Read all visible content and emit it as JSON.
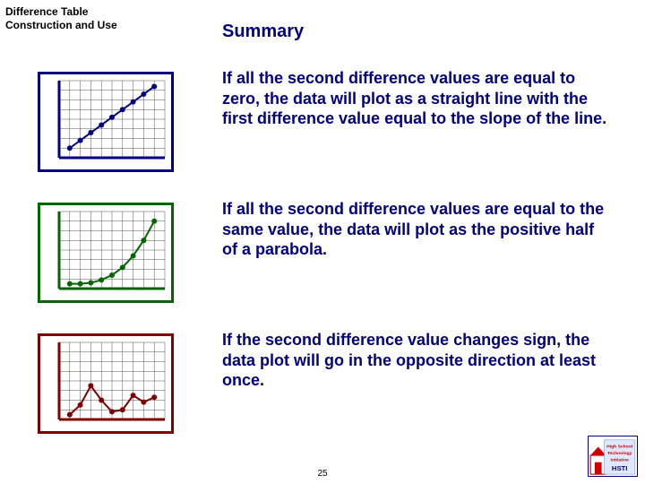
{
  "header": {
    "line1": "Difference Table",
    "line2": "Construction and Use",
    "title": "Summary"
  },
  "sections": [
    {
      "color": "navy",
      "text": "If all the second difference values are equal to zero, the data will plot as a straight line with the first difference value equal to the slope of the line."
    },
    {
      "color": "green",
      "text": "If all the second difference values are equal to the same value, the data will plot as the positive half of a parabola."
    },
    {
      "color": "red",
      "text": "If the second difference value changes sign, the data plot will go in the opposite direction at least once."
    }
  ],
  "chart_data": [
    {
      "type": "line",
      "title": "linear",
      "x": [
        1,
        2,
        3,
        4,
        5,
        6,
        7,
        8,
        9
      ],
      "y": [
        1,
        1.8,
        2.6,
        3.4,
        4.2,
        5.0,
        5.8,
        6.6,
        7.4
      ],
      "color": "#000080",
      "xlim": [
        0,
        10
      ],
      "ylim": [
        0,
        8
      ]
    },
    {
      "type": "line",
      "title": "parabola-half",
      "x": [
        1,
        2,
        3,
        4,
        5,
        6,
        7,
        8,
        9
      ],
      "y": [
        0.5,
        0.5,
        0.6,
        0.9,
        1.4,
        2.2,
        3.4,
        5.0,
        7.0
      ],
      "color": "#006600",
      "xlim": [
        0,
        10
      ],
      "ylim": [
        0,
        8
      ]
    },
    {
      "type": "line",
      "title": "sign-change",
      "x": [
        1,
        2,
        3,
        4,
        5,
        6,
        7,
        8,
        9
      ],
      "y": [
        0.5,
        1.5,
        3.5,
        2.0,
        0.8,
        1.0,
        2.5,
        1.8,
        2.3
      ],
      "color": "#800000",
      "xlim": [
        0,
        10
      ],
      "ylim": [
        0,
        8
      ]
    }
  ],
  "page_number": "25",
  "logo": {
    "line1": "High School",
    "line2": "Technology",
    "line3": "Initiative"
  }
}
